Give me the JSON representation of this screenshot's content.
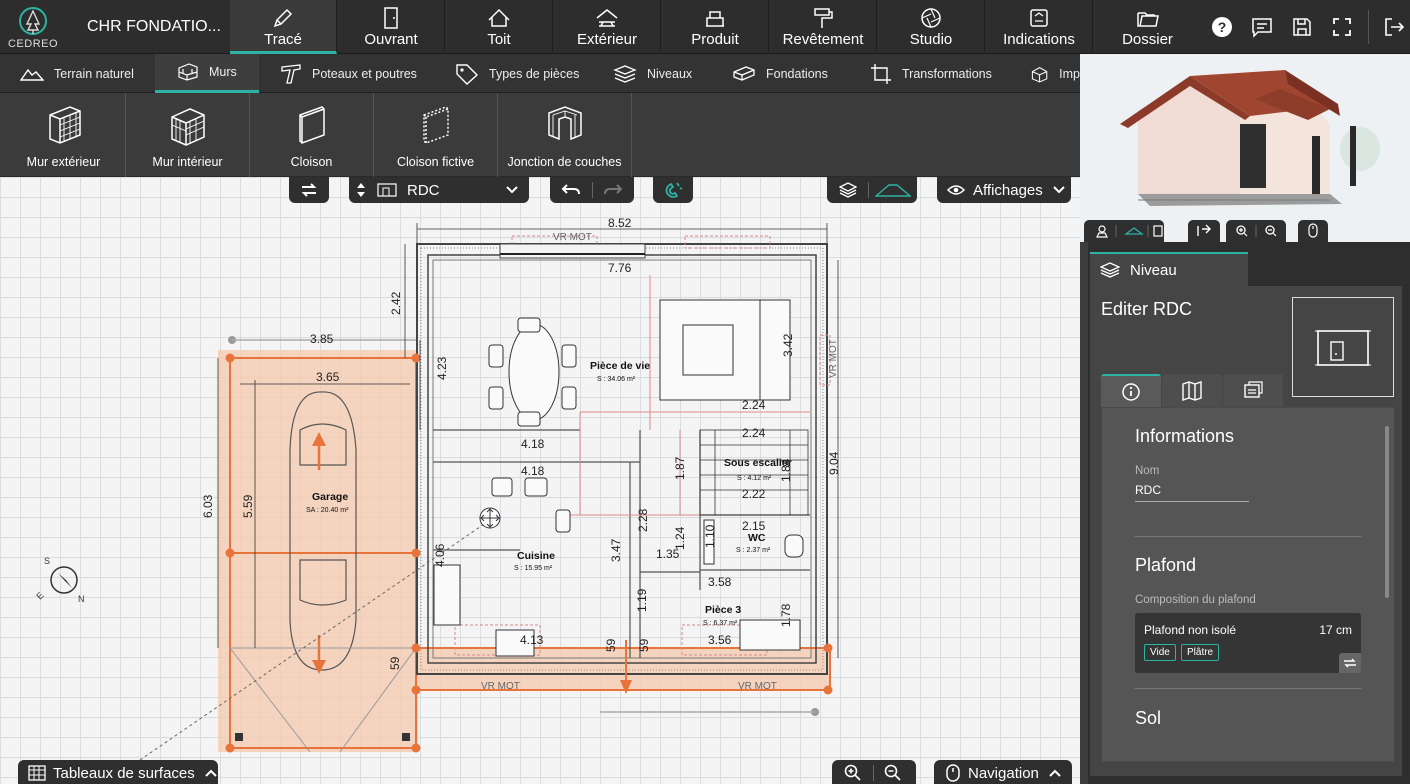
{
  "app": {
    "logo_text": "CEDREO",
    "project_name": "CHR FONDATIO...",
    "accent": "#2bb3a4",
    "plan_color": "#e8743b"
  },
  "top_tabs": [
    {
      "label": "Tracé",
      "icon": "pencil-icon",
      "active": true
    },
    {
      "label": "Ouvrant",
      "icon": "door-icon"
    },
    {
      "label": "Toit",
      "icon": "roof-icon"
    },
    {
      "label": "Extérieur",
      "icon": "exterior-icon"
    },
    {
      "label": "Produit",
      "icon": "furniture-icon"
    },
    {
      "label": "Revêtement",
      "icon": "paint-roller-icon"
    },
    {
      "label": "Studio",
      "icon": "aperture-icon"
    },
    {
      "label": "Indications",
      "icon": "signs-icon"
    },
    {
      "label": "Dossier",
      "icon": "folder-icon"
    }
  ],
  "sub_tabs": [
    {
      "label": "Terrain naturel",
      "icon": "terrain-icon"
    },
    {
      "label": "Murs",
      "icon": "brick-wall-icon",
      "active": true
    },
    {
      "label": "Poteaux et poutres",
      "icon": "beam-icon"
    },
    {
      "label": "Types de pièces",
      "icon": "tag-icon"
    },
    {
      "label": "Niveaux",
      "icon": "layers-icon"
    },
    {
      "label": "Fondations",
      "icon": "foundation-icon"
    },
    {
      "label": "Transformations",
      "icon": "transform-icon"
    },
    {
      "label": "Imp",
      "icon": "import-icon"
    }
  ],
  "tools": [
    {
      "label": "Mur extérieur",
      "icon": "exterior-wall-icon"
    },
    {
      "label": "Mur intérieur",
      "icon": "interior-wall-icon"
    },
    {
      "label": "Cloison",
      "icon": "partition-icon"
    },
    {
      "label": "Cloison fictive",
      "icon": "fictive-partition-icon"
    },
    {
      "label": "Jonction de couches",
      "icon": "layer-junction-icon"
    }
  ],
  "canvas": {
    "level": "RDC",
    "affichages": "Affichages",
    "tableaux": "Tableaux de surfaces",
    "navigation": "Navigation",
    "rooms": [
      {
        "name": "Pièce de vie",
        "area": "S : 34.06 m²"
      },
      {
        "name": "Garage",
        "area": "SA : 20.40 m²"
      },
      {
        "name": "Cuisine",
        "area": "S : 15.95 m²"
      },
      {
        "name": "Sous escalier",
        "area": "S : 4.12 m²"
      },
      {
        "name": "WC",
        "area": "S : 2.37 m²"
      },
      {
        "name": "Pièce 3",
        "area": "S : 6.37 m²"
      }
    ],
    "dimensions": [
      "8.52",
      "7.76",
      "3.85",
      "3.65",
      "2.42",
      "4.23",
      "3.42",
      "4.18",
      "4.18",
      "2.24",
      "2.24",
      "2.22",
      "1.87",
      "1.84",
      "9.04",
      "6.03",
      "5.59",
      "2.28",
      "2.15",
      "3.47",
      "1.35",
      "1.24",
      "1.10",
      "3.58",
      "4.06",
      "1.19",
      "1.78",
      "4.13",
      "3.56",
      "59",
      "59",
      "59"
    ],
    "window_label": "VR MOT"
  },
  "panel": {
    "tab": "Niveau",
    "title": "Editer RDC",
    "informations": "Informations",
    "nom_label": "Nom",
    "nom_value": "RDC",
    "plafond": "Plafond",
    "composition_label": "Composition du plafond",
    "ceiling_name": "Plafond non isolé",
    "ceiling_thickness": "17 cm",
    "chips": [
      "Vide",
      "Plâtre"
    ],
    "sol": "Sol"
  }
}
